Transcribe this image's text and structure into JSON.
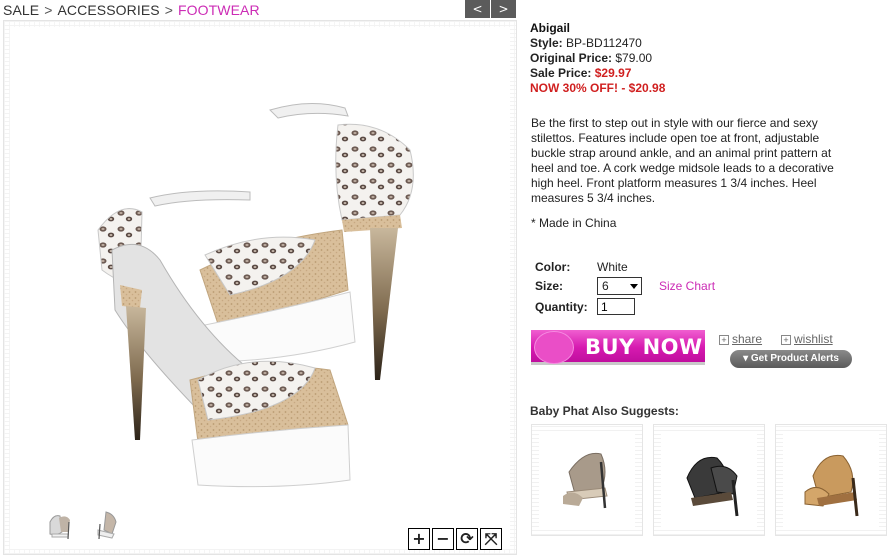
{
  "breadcrumb": {
    "items": [
      "SALE",
      "ACCESSORIES",
      "FOOTWEAR"
    ],
    "separator": ">"
  },
  "gallery_nav": {
    "prev": "<",
    "next": ">"
  },
  "zoom_controls": {
    "in": "+",
    "out": "−",
    "reset": "⟳",
    "fullscreen": "⤧"
  },
  "product": {
    "name": "Abigail",
    "style_label": "Style:",
    "style_value": "BP-BD112470",
    "original_label": "Original Price:",
    "original_value": "$79.00",
    "sale_label": "Sale Price:",
    "sale_value": "$29.97",
    "now_off": "NOW 30% OFF! - $20.98",
    "description": "Be the first to step out in style with our fierce and sexy stilettos. Features include open toe at front, adjustable buckle strap around ankle, and an animal print pattern at heel and toe. A cork wedge midsole leads to a decorative high heel. Front platform measures 1 3/4 inches. Heel measures 5 3/4 inches.",
    "made_in": "* Made in China"
  },
  "options": {
    "color_label": "Color:",
    "color_value": "White",
    "size_label": "Size:",
    "size_value": "6",
    "size_chart": "Size Chart",
    "quantity_label": "Quantity:",
    "quantity_value": "1"
  },
  "actions": {
    "buy_now": "BUY NOW",
    "share": "share",
    "wishlist": "wishlist",
    "alerts": "Get Product Alerts"
  },
  "suggestions": {
    "title": "Baby Phat Also Suggests:"
  },
  "colors": {
    "accent_pink": "#cc2cb5",
    "sale_red": "#d01f1f",
    "buy_button": "#d61ab0"
  }
}
